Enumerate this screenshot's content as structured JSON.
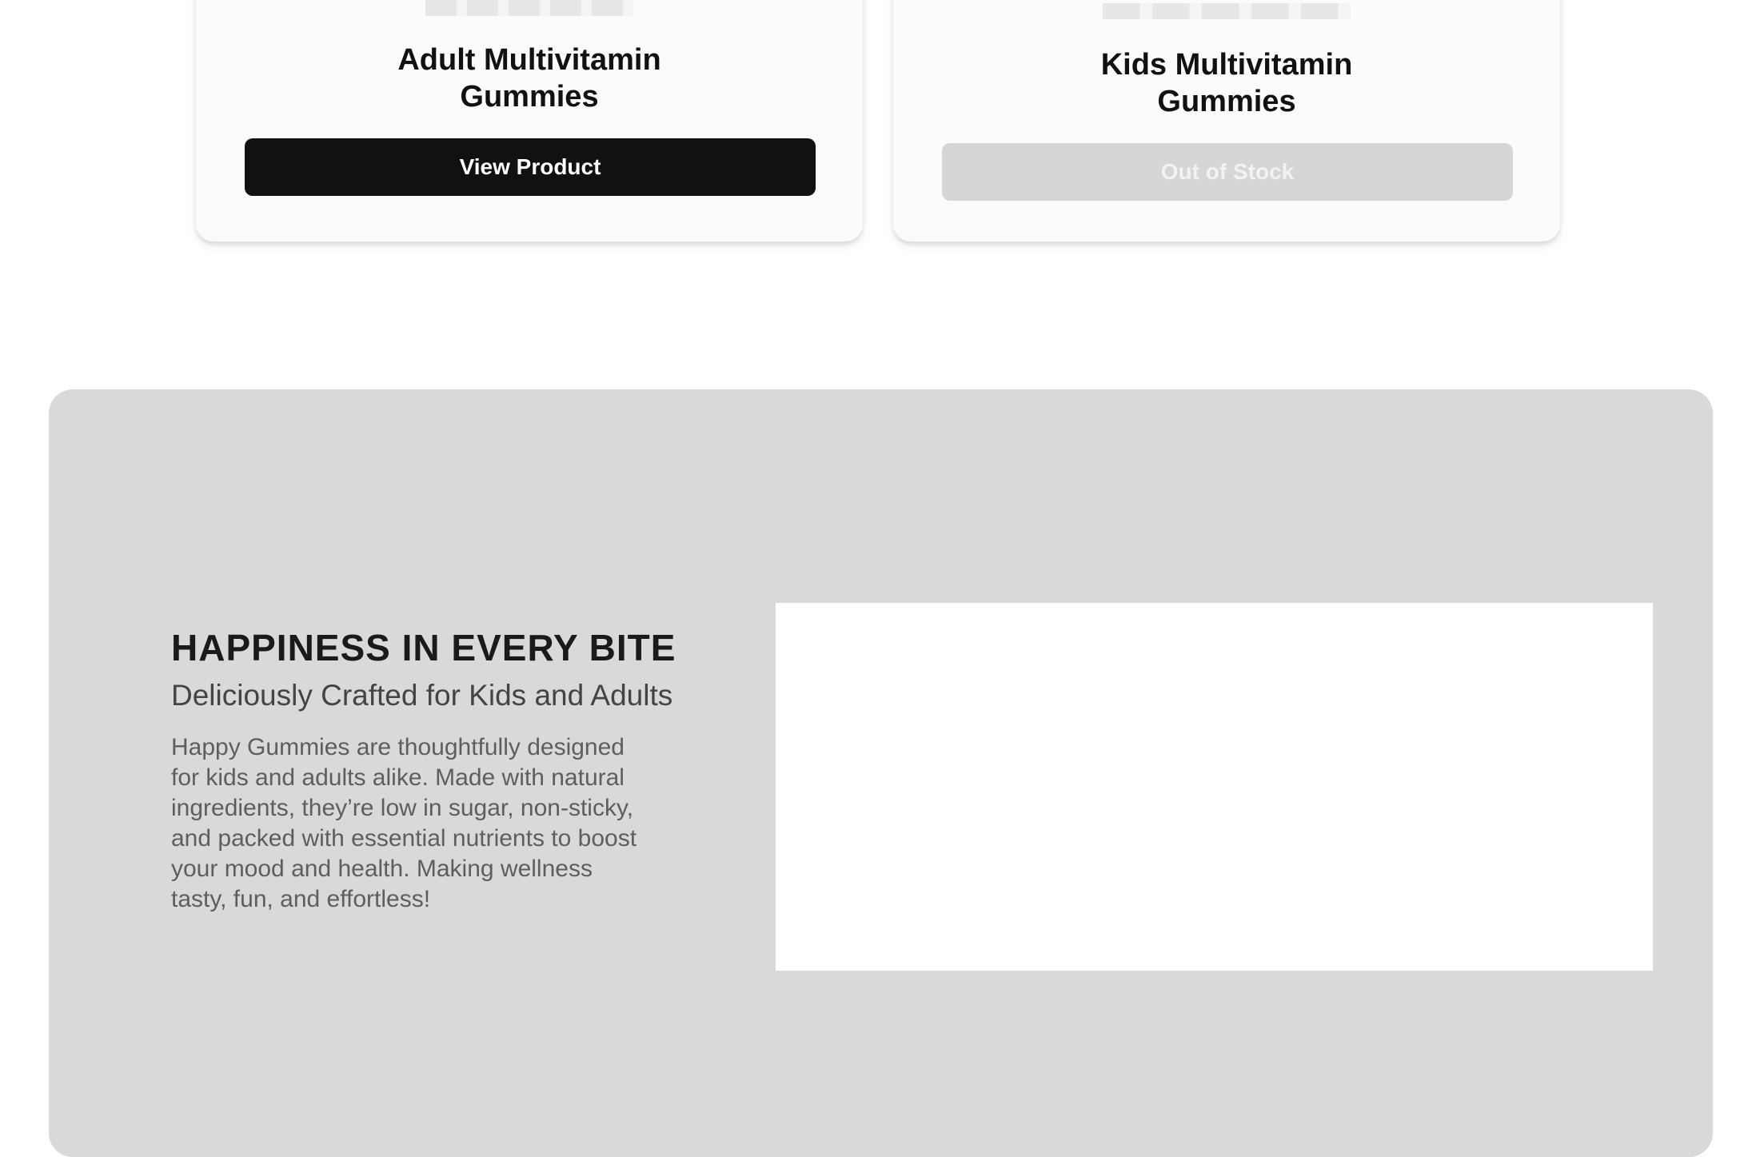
{
  "products": [
    {
      "title_line1": "Adult Multivitamin",
      "title_line2": "Gummies",
      "button_label": "View Product",
      "in_stock": true
    },
    {
      "title_line1": "Kids Multivitamin",
      "title_line2": "Gummies",
      "button_label": "Out of Stock",
      "in_stock": false
    }
  ],
  "feature": {
    "heading": "HAPPINESS IN EVERY BITE",
    "subheading": "Deliciously Crafted for Kids and Adults",
    "body": "Happy Gummies are thoughtfully designed for kids and adults alike. Made with natural ingredients, they’re low in sugar, non-sticky, and packed with essential nutrients to boost your mood and health. Making wellness tasty, fun, and effortless!"
  },
  "colors": {
    "primary_button": "#111111",
    "disabled_button": "#d7d6d5",
    "section_background": "#d9d9d9",
    "card_background": "#fcfbfa"
  }
}
